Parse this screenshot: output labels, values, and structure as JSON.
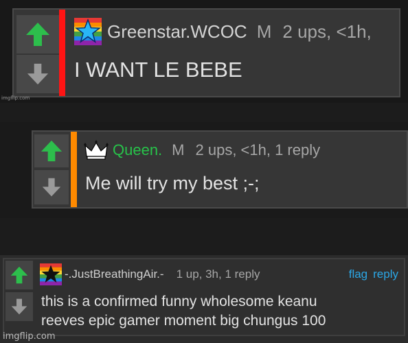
{
  "colors": {
    "upvote": "#2dbe4c",
    "downvote": "#9a9a9a",
    "bar_red": "#ff1414",
    "bar_orange": "#ff8a00",
    "username_green": "#27c34a",
    "link_blue": "#2ba7e6"
  },
  "comments": [
    {
      "username": "Greenstar.WCOC",
      "gender": "M",
      "stats": "2 ups, <1h,",
      "text": "I WANT LE BEBE",
      "badge_icon": "rainbow-star-icon",
      "upvote_icon": "upvote-arrow-icon",
      "downvote_icon": "downvote-arrow-icon"
    },
    {
      "username": "Queen.",
      "gender": "M",
      "stats": "2 ups, <1h, 1 reply",
      "text": "Me will try my best ;-;",
      "badge_icon": "crown-icon",
      "upvote_icon": "upvote-arrow-icon",
      "downvote_icon": "downvote-arrow-icon"
    },
    {
      "username": "-.JustBreathingAir.-",
      "stats": "1 up, 3h, 1 reply",
      "text_line1": "this is a confirmed funny wholesome keanu",
      "text_line2": "reeves epic gamer moment big chungus 100",
      "flag_label": "flag",
      "reply_label": "reply",
      "badge_icon": "rainbow-black-star-icon",
      "upvote_icon": "upvote-arrow-icon",
      "downvote_icon": "downvote-arrow-icon"
    }
  ],
  "watermarks": {
    "small": "imgflip.com",
    "large": "imgflip.com"
  }
}
